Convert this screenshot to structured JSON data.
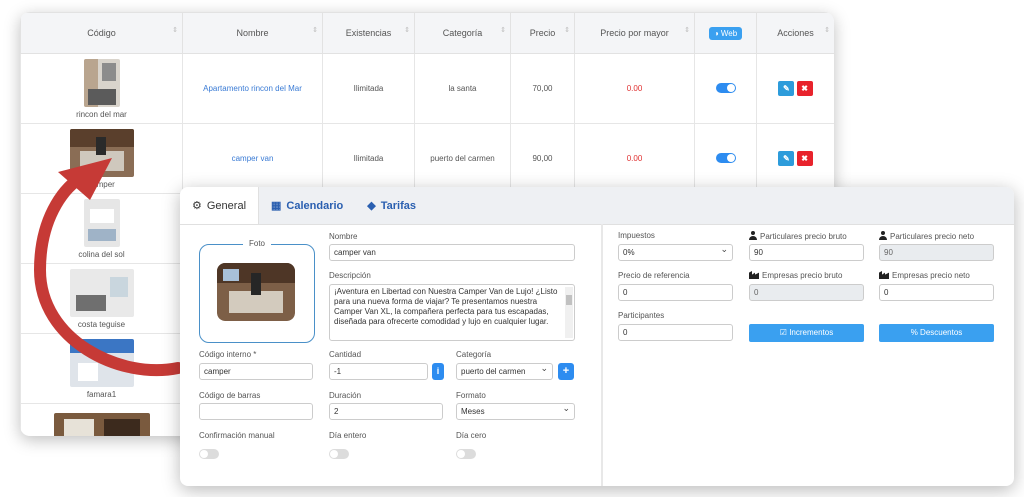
{
  "table": {
    "headers": [
      "Código",
      "Nombre",
      "Existencias",
      "Categoría",
      "Precio",
      "Precio por mayor",
      "Web",
      "Acciones"
    ],
    "rows": [
      {
        "code": "rincon del mar",
        "name": "Apartamento rincon del Mar",
        "stock": "Ilimitada",
        "category": "la santa",
        "price": "70,00",
        "wholesale": "0.00"
      },
      {
        "code": "camper",
        "name": "camper van",
        "stock": "Ilimitada",
        "category": "puerto del carmen",
        "price": "90,00",
        "wholesale": "0.00"
      },
      {
        "code": "colina del sol"
      },
      {
        "code": "costa teguise"
      },
      {
        "code": "famara1"
      },
      {
        "code": ""
      }
    ]
  },
  "tabs": {
    "general": "General",
    "calendario": "Calendario",
    "tarifas": "Tarifas"
  },
  "form": {
    "foto_label": "Foto",
    "nombre_label": "Nombre",
    "nombre_value": "camper van",
    "descripcion_label": "Descripción",
    "descripcion_value": "¡Aventura en Libertad con Nuestra Camper Van de Lujo! ¿Listo para una nueva forma de viajar? Te presentamos nuestra Camper Van XL, la compañera perfecta para tus escapadas, diseñada para ofrecerte comodidad y lujo en cualquier lugar.",
    "codigo_interno_label": "Código interno *",
    "codigo_interno_value": "camper",
    "cantidad_label": "Cantidad",
    "cantidad_value": "-1",
    "categoria_label": "Categoría",
    "categoria_value": "puerto del carmen",
    "codigo_barras_label": "Código de barras",
    "codigo_barras_value": "",
    "duracion_label": "Duración",
    "duracion_value": "2",
    "formato_label": "Formato",
    "formato_value": "Meses",
    "confirmacion_label": "Confirmación manual",
    "dia_entero_label": "Día entero",
    "dia_cero_label": "Día cero"
  },
  "pricing": {
    "impuestos_label": "Impuestos",
    "impuestos_value": "0%",
    "part_bruto_label": "Particulares precio bruto",
    "part_bruto_value": "90",
    "part_neto_label": "Particulares precio neto",
    "part_neto_value": "90",
    "precio_ref_label": "Precio de referencia",
    "precio_ref_value": "0",
    "emp_bruto_label": "Empresas precio bruto",
    "emp_bruto_value": "0",
    "emp_neto_label": "Empresas precio neto",
    "emp_neto_value": "0",
    "participantes_label": "Participantes",
    "participantes_value": "0",
    "incrementos_label": "Incrementos",
    "descuentos_label": "Descuentos"
  },
  "colors": {
    "accent": "#3aa0f0",
    "link": "#3a7bd5",
    "danger": "#e8232c",
    "arrow": "#c63a36"
  },
  "icons": {
    "general": "gear-icon",
    "calendario": "calendar-icon",
    "tarifas": "tag-icon"
  }
}
